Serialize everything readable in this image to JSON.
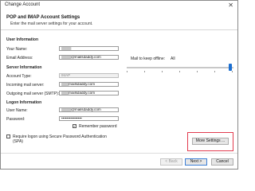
{
  "window": {
    "title": "Change Account"
  },
  "header": {
    "title": "POP and IMAP Account Settings",
    "subtitle": "Enter the mail server settings for your account."
  },
  "user_info": {
    "section_title": "User Information",
    "name_label": "Your Name:",
    "name_value": "████",
    "email_label": "Email Address:",
    "email_value_prefix": "████",
    "email_value_domain": "@mailsdaddy.com"
  },
  "server_info": {
    "section_title": "Server Information",
    "account_type_label": "Account Type:",
    "account_type_value": "IMAP",
    "incoming_label": "Incoming mail server:",
    "incoming_value_prefix": "███",
    "incoming_value_domain": "mailsdaddy.com",
    "outgoing_label": "Outgoing mail server (SMTP):",
    "outgoing_value_prefix": "███",
    "outgoing_value_domain": "mailsdaddy.com"
  },
  "logon_info": {
    "section_title": "Logon Information",
    "username_label": "User Name:",
    "username_value_prefix": "████",
    "username_value_domain": "@mailsdaddy.com",
    "password_label": "Password:",
    "password_value": "••••••••••••••••",
    "remember_label": "Remember password",
    "remember_checked": "✓",
    "spa_label_line1": "Require logon using Secure Password Authentication",
    "spa_label_line2": "(SPA)"
  },
  "offline": {
    "label": "Mail to keep offline:",
    "value": "All",
    "slider_level": 1.0
  },
  "buttons": {
    "more_settings": "More Settings ...",
    "back": "< Back",
    "next": "Next >",
    "cancel": "Cancel"
  },
  "colors": {
    "accent": "#1c6fd1",
    "highlight": "#e23b4e"
  }
}
